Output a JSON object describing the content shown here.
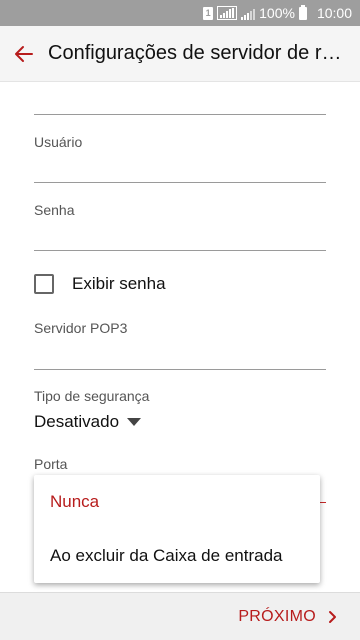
{
  "status_bar": {
    "sim_label": "1",
    "battery_percent": "100%",
    "time": "10:00"
  },
  "app_bar": {
    "title": "Configurações de servidor de rec..."
  },
  "form": {
    "username_label": "Usuário",
    "password_label": "Senha",
    "show_password_label": "Exibir senha",
    "show_password_checked": false,
    "pop3_label": "Servidor POP3",
    "security_label": "Tipo de segurança",
    "security_value": "Desativado",
    "port_label": "Porta"
  },
  "dropdown": {
    "options": [
      "Nunca",
      "Ao excluir da Caixa de entrada"
    ],
    "selected": "Nunca"
  },
  "footer": {
    "next_label": "PRÓXIMO"
  },
  "colors": {
    "accent": "#b71c1c",
    "status_bar": "#9e9e9e"
  }
}
